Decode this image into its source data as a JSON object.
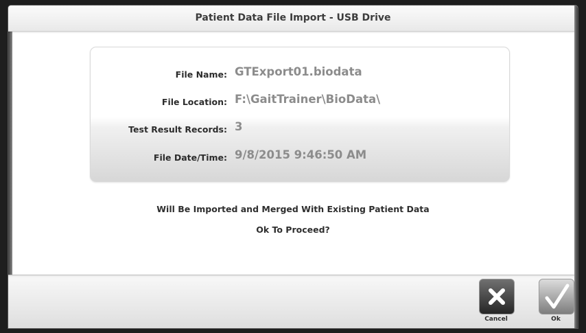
{
  "dialog": {
    "title": "Patient Data File Import - USB Drive"
  },
  "file_info": {
    "file_name": {
      "label": "File Name:",
      "value": "GTExport01.biodata"
    },
    "file_location": {
      "label": "File Location:",
      "value": "F:\\GaitTrainer\\BioData\\"
    },
    "test_result_records": {
      "label": "Test Result Records:",
      "value": "3"
    },
    "file_datetime": {
      "label": "File Date/Time:",
      "value": "9/8/2015 9:46:50 AM"
    }
  },
  "message": {
    "line1": "Will Be Imported and Merged With Existing Patient Data",
    "line2": "Ok To Proceed?"
  },
  "buttons": {
    "cancel": {
      "label": "Cancel",
      "icon": "x-icon"
    },
    "ok": {
      "label": "Ok",
      "icon": "checkmark-icon"
    }
  }
}
